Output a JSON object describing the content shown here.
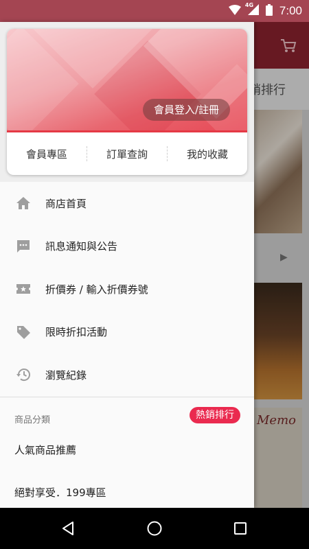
{
  "status_bar": {
    "time": "7:00",
    "network_label": "4G"
  },
  "drawer": {
    "login_label": "會員登入/註冊",
    "card_tabs": [
      {
        "label": "會員專區"
      },
      {
        "label": "訂單查詢"
      },
      {
        "label": "我的收藏"
      }
    ],
    "menu": [
      {
        "label": "商店首頁",
        "icon": "home-icon"
      },
      {
        "label": "訊息通知與公告",
        "icon": "message-icon"
      },
      {
        "label": "折價券 / 輸入折價券號",
        "icon": "coupon-icon"
      },
      {
        "label": "限時折扣活動",
        "icon": "tag-icon"
      },
      {
        "label": "瀏覽紀錄",
        "icon": "history-icon"
      }
    ],
    "section_title": "商品分類",
    "hot_badge": "熱銷排行",
    "categories": [
      {
        "label": "人氣商品推薦"
      },
      {
        "label": "絕對享受．199專區"
      }
    ]
  },
  "background": {
    "tab_label": "銷排行",
    "memo_text": "Memo"
  },
  "colors": {
    "accent": "#e53945",
    "status_bar": "#a44552",
    "badge": "#ea2a4f"
  }
}
